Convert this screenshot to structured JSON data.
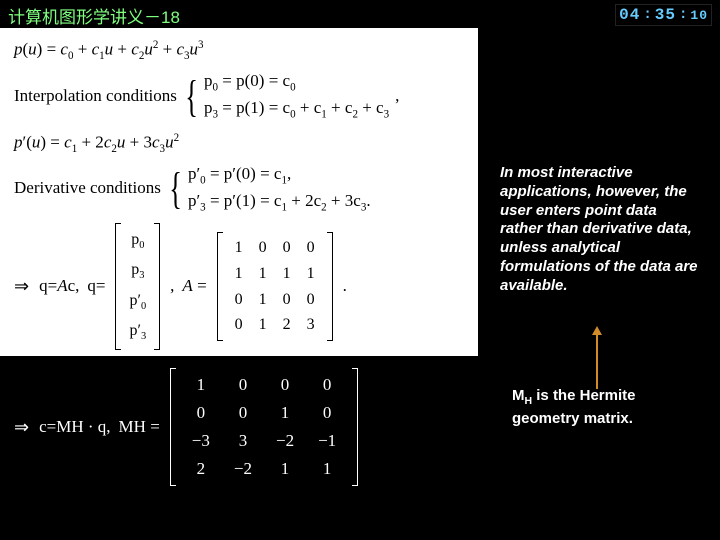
{
  "header": {
    "title": "计算机图形学讲义－18",
    "clock": {
      "hh": "04",
      "mm": "35",
      "ss": "10"
    }
  },
  "math": {
    "poly": "p(u) = c₀ + c₁u + c₂u² + c₃u³",
    "interp_label": "Interpolation conditions",
    "interp_1": "p₀ = p(0) = c₀",
    "interp_2": "p₃ = p(1) = c₀ + c₁ + c₂ + c₃",
    "deriv_poly": "p′(u) = c₁ + 2c₂u + 3c₃u²",
    "deriv_label": "Derivative conditions",
    "deriv_1": "p′₀ = p′(0) = c₁,",
    "deriv_2": "p′₃ = p′(1) = c₁ + 2c₂ + 3c₃.",
    "qAc": "q=Ac,",
    "q_eq": "q=",
    "q_vec": [
      "p₀",
      "p₃",
      "p′₀",
      "p′₃"
    ],
    "A_eq": "A =",
    "A": [
      [
        "1",
        "0",
        "0",
        "0"
      ],
      [
        "1",
        "1",
        "1",
        "1"
      ],
      [
        "0",
        "1",
        "0",
        "0"
      ],
      [
        "0",
        "1",
        "2",
        "3"
      ]
    ],
    "cMHq": "c=M_H · q,",
    "MH_eq": "M_H =",
    "MH": [
      [
        "1",
        "0",
        "0",
        "0"
      ],
      [
        "0",
        "0",
        "1",
        "0"
      ],
      [
        "−3",
        "3",
        "−2",
        "−1"
      ],
      [
        "2",
        "−2",
        "1",
        "1"
      ]
    ],
    "implies": "⇒",
    "comma": ",",
    "period": "."
  },
  "side": {
    "note": "In most interactive applications, however, the user enters point data rather than derivative data, unless analytical formulations of the data are available.",
    "caption_pre": "M",
    "caption_sub": "H",
    "caption_post": " is the Hermite geometry matrix."
  }
}
